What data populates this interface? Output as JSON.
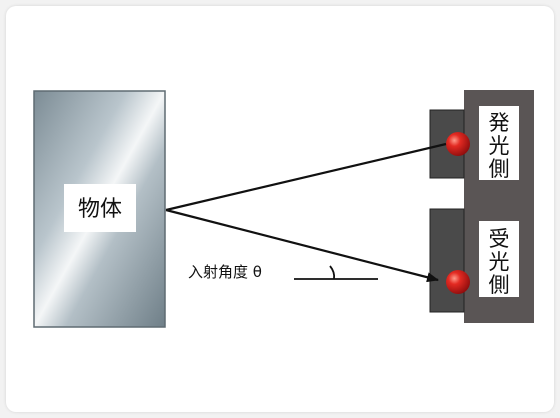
{
  "diagram": {
    "object_label": "物体",
    "emitter_label": [
      "発",
      "光",
      "側"
    ],
    "receiver_label": [
      "受",
      "光",
      "側"
    ],
    "angle_label": "入射角度 θ"
  },
  "colors": {
    "frame": "#5a5555",
    "sensor_body": "#4a4a4a",
    "led": "#d81e1e",
    "line": "#111111"
  }
}
